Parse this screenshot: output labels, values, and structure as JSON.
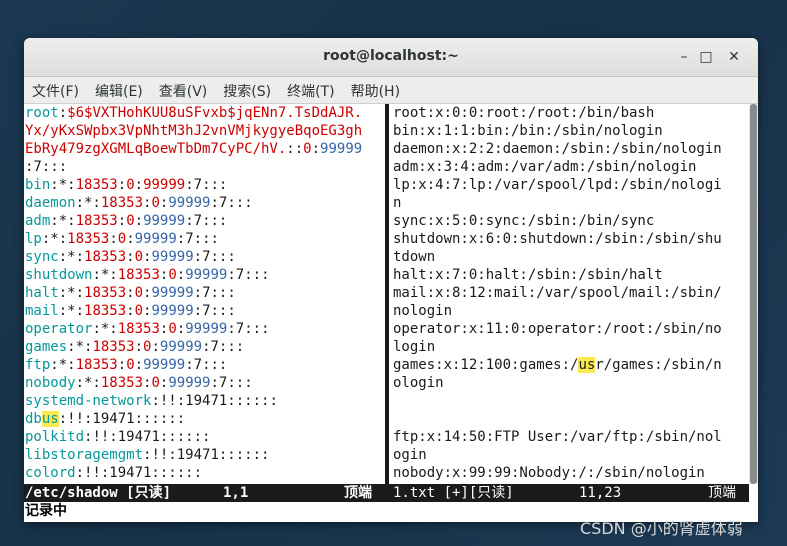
{
  "window": {
    "title": "root@localhost:~",
    "buttons": [
      "–",
      "□",
      "✕"
    ]
  },
  "menu": [
    "文件(F)",
    "编辑(E)",
    "查看(V)",
    "搜索(S)",
    "终端(T)",
    "帮助(H)"
  ],
  "left_lines": [
    [
      [
        "root",
        "cyan"
      ],
      [
        ":",
        "blk"
      ],
      [
        "$6$VXTHohKUU8uSFvxb$jqENn7.TsDdAJR.",
        "red"
      ]
    ],
    [
      [
        "Yx/yKxSWpbx3VpNhtM3hJ2vnVMjkygyeBqoEG3gh",
        "red"
      ]
    ],
    [
      [
        "EbRy479zgXGMLqBoewTbDm7CyPC/hV.",
        "red"
      ],
      [
        "::",
        "blk"
      ],
      [
        "0",
        "red"
      ],
      [
        ":",
        "blk"
      ],
      [
        "99999",
        "blue"
      ]
    ],
    [
      [
        ":7:::",
        "blk"
      ]
    ],
    [
      [
        "bin",
        "cyan"
      ],
      [
        ":*:",
        "blk"
      ],
      [
        "18353",
        "red"
      ],
      [
        ":",
        "blk"
      ],
      [
        "0",
        "red"
      ],
      [
        ":",
        "blk"
      ],
      [
        "99999",
        "red"
      ],
      [
        ":7:::",
        "blk"
      ]
    ],
    [
      [
        "daemon",
        "cyan"
      ],
      [
        ":*:",
        "blk"
      ],
      [
        "18353",
        "red"
      ],
      [
        ":",
        "blk"
      ],
      [
        "0",
        "red"
      ],
      [
        ":",
        "blk"
      ],
      [
        "99999",
        "blue"
      ],
      [
        ":7:::",
        "blk"
      ]
    ],
    [
      [
        "adm",
        "cyan"
      ],
      [
        ":*:",
        "blk"
      ],
      [
        "18353",
        "red"
      ],
      [
        ":",
        "blk"
      ],
      [
        "0",
        "red"
      ],
      [
        ":",
        "blk"
      ],
      [
        "99999",
        "blue"
      ],
      [
        ":7:::",
        "blk"
      ]
    ],
    [
      [
        "lp",
        "cyan"
      ],
      [
        ":*:",
        "blk"
      ],
      [
        "18353",
        "red"
      ],
      [
        ":",
        "blk"
      ],
      [
        "0",
        "red"
      ],
      [
        ":",
        "blk"
      ],
      [
        "99999",
        "blue"
      ],
      [
        ":7:::",
        "blk"
      ]
    ],
    [
      [
        "sync",
        "cyan"
      ],
      [
        ":*:",
        "blk"
      ],
      [
        "18353",
        "red"
      ],
      [
        ":",
        "blk"
      ],
      [
        "0",
        "red"
      ],
      [
        ":",
        "blk"
      ],
      [
        "99999",
        "blue"
      ],
      [
        ":7:::",
        "blk"
      ]
    ],
    [
      [
        "shutdown",
        "cyan"
      ],
      [
        ":*:",
        "blk"
      ],
      [
        "18353",
        "red"
      ],
      [
        ":",
        "blk"
      ],
      [
        "0",
        "red"
      ],
      [
        ":",
        "blk"
      ],
      [
        "99999",
        "blue"
      ],
      [
        ":7:::",
        "blk"
      ]
    ],
    [
      [
        "halt",
        "cyan"
      ],
      [
        ":*:",
        "blk"
      ],
      [
        "18353",
        "red"
      ],
      [
        ":",
        "blk"
      ],
      [
        "0",
        "red"
      ],
      [
        ":",
        "blk"
      ],
      [
        "99999",
        "blue"
      ],
      [
        ":7:::",
        "blk"
      ]
    ],
    [
      [
        "mail",
        "cyan"
      ],
      [
        ":*:",
        "blk"
      ],
      [
        "18353",
        "red"
      ],
      [
        ":",
        "blk"
      ],
      [
        "0",
        "red"
      ],
      [
        ":",
        "blk"
      ],
      [
        "99999",
        "blue"
      ],
      [
        ":7:::",
        "blk"
      ]
    ],
    [
      [
        "operator",
        "cyan"
      ],
      [
        ":*:",
        "blk"
      ],
      [
        "18353",
        "red"
      ],
      [
        ":",
        "blk"
      ],
      [
        "0",
        "red"
      ],
      [
        ":",
        "blk"
      ],
      [
        "99999",
        "blue"
      ],
      [
        ":7:::",
        "blk"
      ]
    ],
    [
      [
        "games",
        "cyan"
      ],
      [
        ":*:",
        "blk"
      ],
      [
        "18353",
        "red"
      ],
      [
        ":",
        "blk"
      ],
      [
        "0",
        "red"
      ],
      [
        ":",
        "blk"
      ],
      [
        "99999",
        "blue"
      ],
      [
        ":7:::",
        "blk"
      ]
    ],
    [
      [
        "ftp",
        "cyan"
      ],
      [
        ":*:",
        "blk"
      ],
      [
        "18353",
        "red"
      ],
      [
        ":",
        "blk"
      ],
      [
        "0",
        "red"
      ],
      [
        ":",
        "blk"
      ],
      [
        "99999",
        "blue"
      ],
      [
        ":7:::",
        "blk"
      ]
    ],
    [
      [
        "nobody",
        "cyan"
      ],
      [
        ":*:",
        "blk"
      ],
      [
        "18353",
        "red"
      ],
      [
        ":",
        "blk"
      ],
      [
        "0",
        "red"
      ],
      [
        ":",
        "blk"
      ],
      [
        "99999",
        "blue"
      ],
      [
        ":7:::",
        "blk"
      ]
    ],
    [
      [
        "systemd-network",
        "cyan"
      ],
      [
        ":!!:19471::::::",
        "blk"
      ]
    ],
    [
      [
        "db",
        "cyan"
      ],
      [
        "us",
        "cyan hl"
      ],
      [
        ":!!:19471::::::",
        "blk"
      ]
    ],
    [
      [
        "polkitd",
        "cyan"
      ],
      [
        ":!!:19471::::::",
        "blk"
      ]
    ],
    [
      [
        "libstoragemgmt",
        "cyan"
      ],
      [
        ":!!:19471::::::",
        "blk"
      ]
    ],
    [
      [
        "colord",
        "cyan"
      ],
      [
        ":!!:19471::::::",
        "blk"
      ]
    ]
  ],
  "right_lines": [
    [
      [
        "root:x:0:0:root:/root:/bin/bash",
        "blk"
      ]
    ],
    [
      [
        "bin:x:1:1:bin:/bin:/sbin/nologin",
        "blk"
      ]
    ],
    [
      [
        "daemon:x:2:2:daemon:/sbin:/sbin/nologin",
        "blk"
      ]
    ],
    [
      [
        "adm:x:3:4:adm:/var/adm:/sbin/nologin",
        "blk"
      ]
    ],
    [
      [
        "lp:x:4:7:lp:/var/spool/lpd:/sbin/nologi",
        "blk"
      ]
    ],
    [
      [
        "n",
        "blk"
      ]
    ],
    [
      [
        "sync:x:5:0:sync:/sbin:/bin/sync",
        "blk"
      ]
    ],
    [
      [
        "shutdown:x:6:0:shutdown:/sbin:/sbin/shu",
        "blk"
      ]
    ],
    [
      [
        "tdown",
        "blk"
      ]
    ],
    [
      [
        "halt:x:7:0:halt:/sbin:/sbin/halt",
        "blk"
      ]
    ],
    [
      [
        "mail:x:8:12:mail:/var/spool/mail:/sbin/",
        "blk"
      ]
    ],
    [
      [
        "nologin",
        "blk"
      ]
    ],
    [
      [
        "operator:x:11:0:operator:/root:/sbin/no",
        "blk"
      ]
    ],
    [
      [
        "login",
        "blk"
      ]
    ],
    [
      [
        "games:x:12:100:games:/",
        "blk"
      ],
      [
        "us",
        "blk hl"
      ],
      [
        "r/games:/sbin/n",
        "blk"
      ]
    ],
    [
      [
        "ologin",
        "blk"
      ]
    ],
    [
      [
        "",
        "blk"
      ]
    ],
    [
      [
        "",
        "blk"
      ]
    ],
    [
      [
        "ftp:x:14:50:FTP User:/var/ftp:/sbin/nol",
        "blk"
      ]
    ],
    [
      [
        "ogin",
        "blk"
      ]
    ],
    [
      [
        "nobody:x:99:99:Nobody:/:/sbin/nologin",
        "blk"
      ]
    ]
  ],
  "status_left": {
    "file": "/etc/shadow [只读]",
    "pos": "1,1",
    "where": "顶端"
  },
  "status_right": {
    "file": "1.txt [+][只读]",
    "pos": "11,23",
    "where": "顶端"
  },
  "command_line": "记录中",
  "watermark": "CSDN @小的肾虚体弱"
}
